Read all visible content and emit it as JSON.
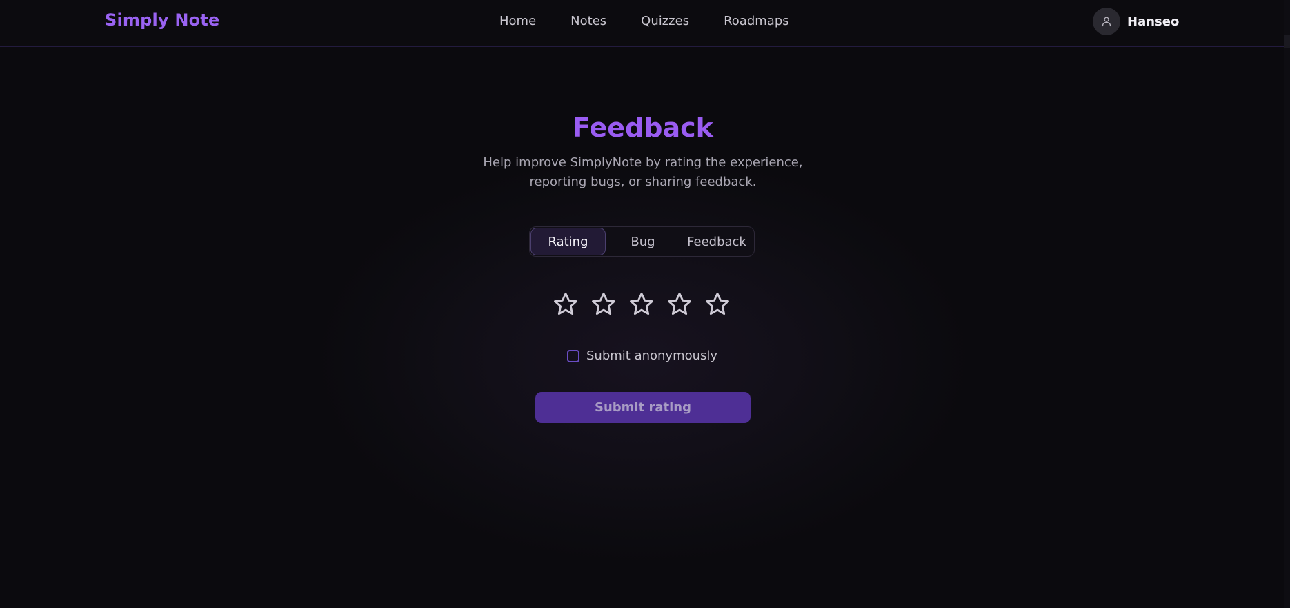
{
  "header": {
    "brand": "Simply Note",
    "nav": [
      {
        "label": "Home"
      },
      {
        "label": "Notes"
      },
      {
        "label": "Quizzes"
      },
      {
        "label": "Roadmaps"
      }
    ],
    "user": {
      "name": "Hanseo",
      "avatar_icon": "user-icon"
    }
  },
  "feedback": {
    "title": "Feedback",
    "subtitle_line1": "Help improve SimplyNote by rating the experience,",
    "subtitle_line2": "reporting bugs, or sharing feedback.",
    "tabs": [
      {
        "label": "Rating",
        "active": true
      },
      {
        "label": "Bug",
        "active": false
      },
      {
        "label": "Feedback",
        "active": false
      }
    ],
    "rating": {
      "max": 5,
      "selected": 0,
      "star_icon": "star-outline-icon"
    },
    "anonymous": {
      "label": "Submit anonymously",
      "checked": false
    },
    "submit_label": "Submit rating"
  },
  "colors": {
    "accent": "#9a5cf2",
    "button": "#4e2f95",
    "background": "#0b0a0e"
  }
}
